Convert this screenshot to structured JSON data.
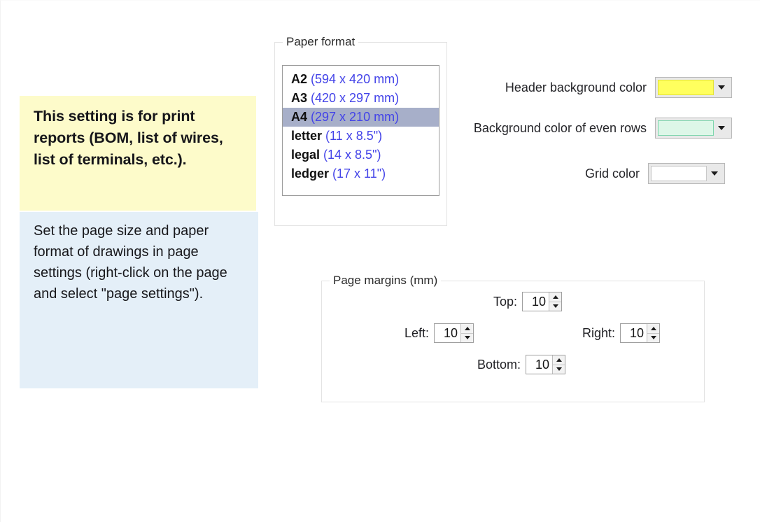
{
  "notes": {
    "yellow": "This setting is for print reports (BOM, list of wires, list of terminals, etc.).",
    "blue": "Set the page size and paper format of drawings in page settings (right-click on the page and select \"page settings\")."
  },
  "paper_format": {
    "legend": "Paper format",
    "items": [
      {
        "name": "A2",
        "dimensions": "(594 x 420 mm)",
        "selected": false
      },
      {
        "name": "A3",
        "dimensions": "(420 x 297 mm)",
        "selected": false
      },
      {
        "name": "A4",
        "dimensions": "(297 x 210 mm)",
        "selected": true
      },
      {
        "name": "letter",
        "dimensions": "(11 x 8.5\")",
        "selected": false
      },
      {
        "name": "legal",
        "dimensions": "(14 x 8.5\")",
        "selected": false
      },
      {
        "name": "ledger",
        "dimensions": "(17 x 11\")",
        "selected": false
      }
    ],
    "selected_value": "A4"
  },
  "colors": {
    "header_background": {
      "label": "Header background color",
      "value": "#ffff5e",
      "border": "#e3e33a",
      "icon": "chevron-down-icon"
    },
    "even_rows_background": {
      "label": "Background color of even rows",
      "value": "#ddf7e8",
      "border": "#7fd6ae",
      "icon": "chevron-down-icon"
    },
    "grid": {
      "label": "Grid color",
      "value": "#ffffff",
      "border": "#c9c9c9",
      "icon": "chevron-down-icon"
    }
  },
  "page_margins": {
    "legend": "Page margins (mm)",
    "top": {
      "label": "Top:",
      "value": "10"
    },
    "left": {
      "label": "Left:",
      "value": "10"
    },
    "right": {
      "label": "Right:",
      "value": "10"
    },
    "bottom": {
      "label": "Bottom:",
      "value": "10"
    }
  }
}
